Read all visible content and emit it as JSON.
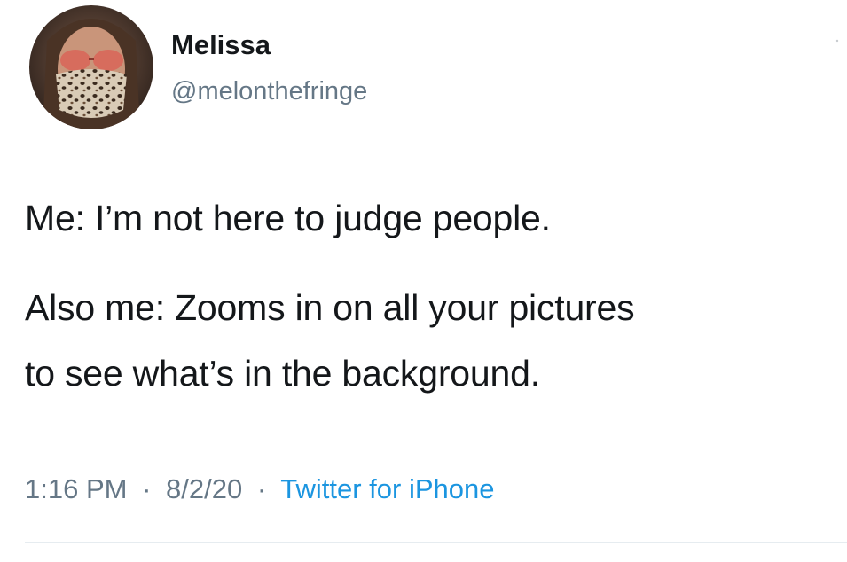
{
  "author": {
    "name": "Melissa",
    "handle": "@melonthefringe",
    "avatar_icon": "profile-photo-masked-woman"
  },
  "tweet": {
    "line_1": "Me: I’m not here to judge people.",
    "line_2": "Also me: Zooms in on all your pictures",
    "line_3": "to see what’s in the background."
  },
  "meta": {
    "time": "1:16 PM",
    "separator": "·",
    "date": "8/2/20",
    "source": "Twitter for iPhone"
  },
  "colors": {
    "text_primary": "#14171a",
    "text_secondary": "#657786",
    "link_blue": "#1b95e0",
    "divider": "#e6ecf0"
  }
}
